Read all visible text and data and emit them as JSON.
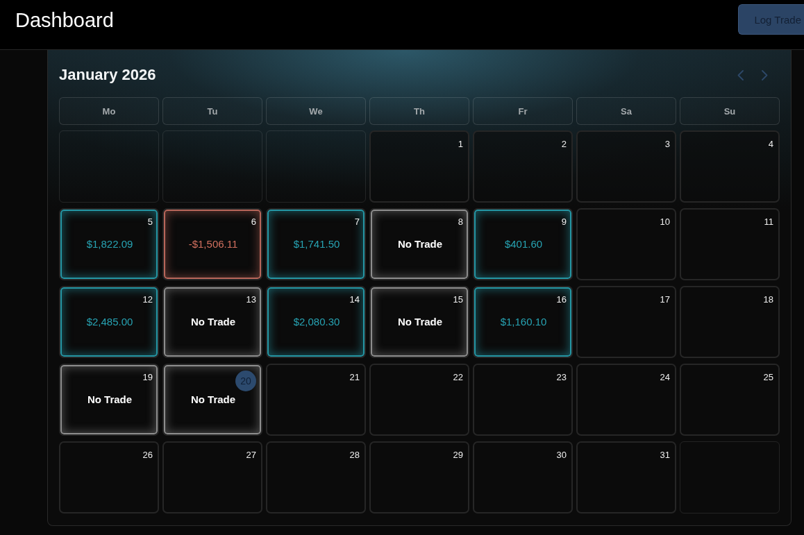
{
  "header": {
    "title": "Dashboard",
    "action_button": "Log Trade"
  },
  "calendar": {
    "title": "January 2026",
    "weekdays": [
      "Mo",
      "Tu",
      "We",
      "Th",
      "Fr",
      "Sa",
      "Su"
    ],
    "days": [
      {
        "kind": "blank"
      },
      {
        "kind": "blank"
      },
      {
        "kind": "blank"
      },
      {
        "kind": "day",
        "day": "1",
        "today": false
      },
      {
        "kind": "day",
        "day": "2",
        "today": false
      },
      {
        "kind": "day",
        "day": "3",
        "today": false
      },
      {
        "kind": "day",
        "day": "4",
        "today": false
      },
      {
        "kind": "profit",
        "day": "5",
        "today": false,
        "result": "$1,822.09"
      },
      {
        "kind": "loss",
        "day": "6",
        "today": false,
        "result": "-$1,506.11"
      },
      {
        "kind": "profit",
        "day": "7",
        "today": false,
        "result": "$1,741.50"
      },
      {
        "kind": "no_trade",
        "day": "8",
        "today": false,
        "result": "No Trade"
      },
      {
        "kind": "profit",
        "day": "9",
        "today": false,
        "result": "$401.60"
      },
      {
        "kind": "day",
        "day": "10",
        "today": false
      },
      {
        "kind": "day",
        "day": "11",
        "today": false
      },
      {
        "kind": "profit",
        "day": "12",
        "today": false,
        "result": "$2,485.00"
      },
      {
        "kind": "no_trade",
        "day": "13",
        "today": false,
        "result": "No Trade"
      },
      {
        "kind": "profit",
        "day": "14",
        "today": false,
        "result": "$2,080.30"
      },
      {
        "kind": "no_trade",
        "day": "15",
        "today": false,
        "result": "No Trade"
      },
      {
        "kind": "profit",
        "day": "16",
        "today": false,
        "result": "$1,160.10"
      },
      {
        "kind": "day",
        "day": "17",
        "today": false
      },
      {
        "kind": "day",
        "day": "18",
        "today": false
      },
      {
        "kind": "no_trade",
        "day": "19",
        "today": false,
        "result": "No Trade"
      },
      {
        "kind": "no_trade",
        "day": "20",
        "today": true,
        "result": "No Trade"
      },
      {
        "kind": "day",
        "day": "21",
        "today": false
      },
      {
        "kind": "day",
        "day": "22",
        "today": false
      },
      {
        "kind": "day",
        "day": "23",
        "today": false
      },
      {
        "kind": "day",
        "day": "24",
        "today": false
      },
      {
        "kind": "day",
        "day": "25",
        "today": false
      },
      {
        "kind": "day",
        "day": "26",
        "today": false
      },
      {
        "kind": "day",
        "day": "27",
        "today": false
      },
      {
        "kind": "day",
        "day": "28",
        "today": false
      },
      {
        "kind": "day",
        "day": "29",
        "today": false
      },
      {
        "kind": "day",
        "day": "30",
        "today": false
      },
      {
        "kind": "day",
        "day": "31",
        "today": false
      },
      {
        "kind": "blank"
      }
    ]
  }
}
